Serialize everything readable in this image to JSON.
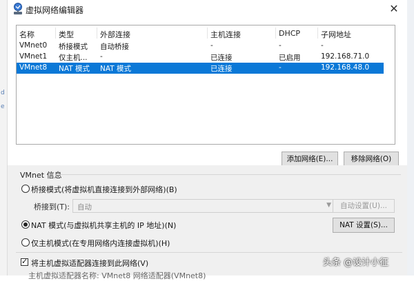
{
  "window": {
    "title": "虚拟网络编辑器",
    "close_glyph": "✕"
  },
  "side": {
    "left_mark_1": "d",
    "left_mark_2": "e"
  },
  "network_table": {
    "columns": [
      "名称",
      "类型",
      "外部连接",
      "主机连接",
      "DHCP",
      "子网地址"
    ],
    "rows": [
      {
        "name": "VMnet0",
        "type": "桥接模式",
        "external": "自动桥接",
        "host": "-",
        "dhcp": "-",
        "subnet": "-",
        "selected": false
      },
      {
        "name": "VMnet1",
        "type": "仅主机...",
        "external": "-",
        "host": "已连接",
        "dhcp": "已启用",
        "subnet": "192.168.71.0",
        "selected": false
      },
      {
        "name": "VMnet8",
        "type": "NAT 模式",
        "external": "NAT 模式",
        "host": "已连接",
        "dhcp": "-",
        "subnet": "192.168.48.0",
        "selected": true
      }
    ]
  },
  "buttons": {
    "add_network": "添加网络(E)...",
    "remove_network": "移除网络(O)",
    "auto_settings": "自动设置(U)...",
    "nat_settings": "NAT 设置(S)..."
  },
  "vmnet_info": {
    "group_label": "VMnet 信息",
    "bridge_mode": "桥接模式(将虚拟机直接连接到外部网络)(B)",
    "bridge_to_label": "桥接到(T):",
    "bridge_to_value": "自动",
    "nat_mode": "NAT 模式(与虚拟机共享主机的 IP 地址)(N)",
    "host_only_mode": "仅主机模式(在专用网络内连接虚拟机)(H)",
    "selected_mode": "nat",
    "connect_adapter": "将主机虚拟适配器连接到此网络(V)",
    "connect_adapter_checked": true,
    "cutoff_text": "主机虚拟适配器名称: VMnet8 网络适配器(VMnet8)"
  },
  "watermark": "头条 @设计小征",
  "colors": {
    "selection": "#0a78d7",
    "panel": "#f0f0f0"
  }
}
